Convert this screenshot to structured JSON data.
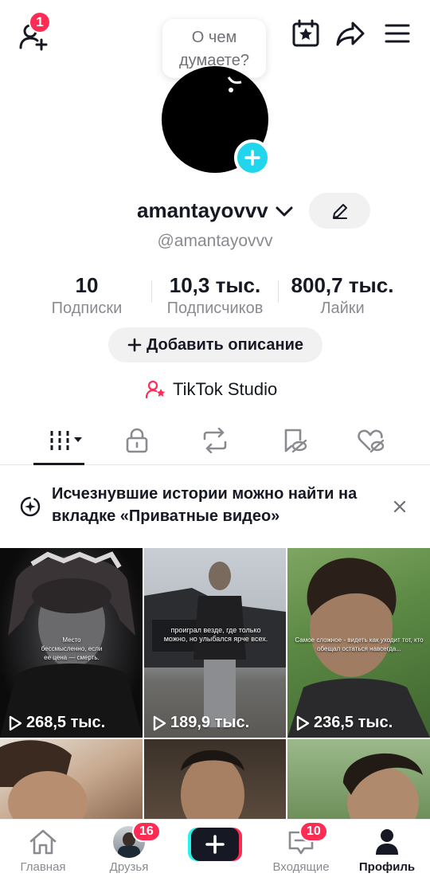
{
  "top_bar": {
    "add_friends_badge": "1",
    "bubble_text_line1": "О чем",
    "bubble_text_line2": "думаете?"
  },
  "profile": {
    "username": "amantayovvv",
    "handle": "@amantayovvv",
    "stats": [
      {
        "value": "10",
        "label": "Подписки"
      },
      {
        "value": "10,3 тыс.",
        "label": "Подписчиков"
      },
      {
        "value": "800,7 тыс.",
        "label": "Лайки"
      }
    ],
    "add_description_label": "Добавить описание",
    "studio_label": "TikTok Studio"
  },
  "tabs": [
    {
      "name": "videos",
      "icon": "grid-icon",
      "active": true
    },
    {
      "name": "private",
      "icon": "lock-icon",
      "active": false
    },
    {
      "name": "reposts",
      "icon": "repost-icon",
      "active": false
    },
    {
      "name": "favorites",
      "icon": "bookmark-hidden-icon",
      "active": false
    },
    {
      "name": "liked",
      "icon": "heart-hidden-icon",
      "active": false
    }
  ],
  "notice": {
    "text": "Исчезнувшие истории можно найти на вкладке «Приватные видео»"
  },
  "videos": [
    {
      "views": "268,5 тыс.",
      "caption": "Место бессмысленно, если ее цена — смерть."
    },
    {
      "views": "189,9 тыс.",
      "caption": "проиграл везде, где только можно, но улыбался ярче всех."
    },
    {
      "views": "236,5 тыс.",
      "caption": "Самое сложное - видеть как уходит тот, кто обещал остаться навсегда..."
    },
    {
      "views": "",
      "caption": ""
    },
    {
      "views": "",
      "caption": ""
    },
    {
      "views": "",
      "caption": ""
    }
  ],
  "bottom_nav": {
    "home": "Главная",
    "friends": "Друзья",
    "friends_badge": "16",
    "inbox": "Входящие",
    "inbox_badge": "10",
    "profile": "Профиль"
  },
  "colors": {
    "accent_red": "#fe2c55",
    "accent_cyan": "#20d5ec",
    "text_primary": "#161823",
    "text_secondary": "#8a8b91"
  }
}
